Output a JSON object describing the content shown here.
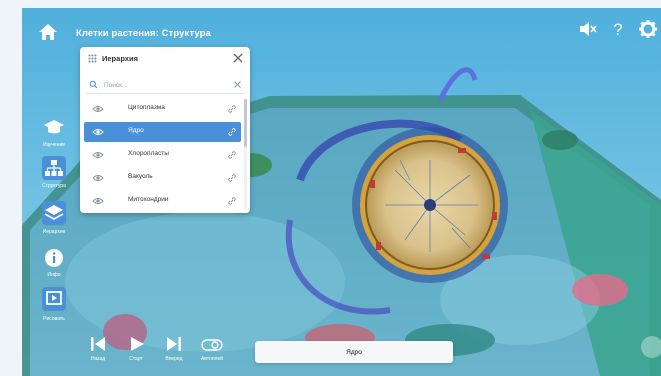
{
  "app": {
    "title": "Клетки растения: Структура"
  },
  "panel": {
    "title": "Иерархия",
    "search_placeholder": "Поиск...",
    "items": [
      {
        "label": "Цитоплазма",
        "selected": false
      },
      {
        "label": "Ядро",
        "selected": true
      },
      {
        "label": "Хлоропласты",
        "selected": false
      },
      {
        "label": "Вакуоль",
        "selected": false
      },
      {
        "label": "Митохондрии",
        "selected": false
      }
    ]
  },
  "sidebar": {
    "items": [
      {
        "label": "Изучение",
        "icon": "graduation-cap-icon"
      },
      {
        "label": "Структура",
        "icon": "hierarchy-icon"
      },
      {
        "label": "Иерархия",
        "icon": "layers-icon"
      },
      {
        "label": "Инфо",
        "icon": "info-icon"
      },
      {
        "label": "Рисовать",
        "icon": "presentation-icon"
      }
    ]
  },
  "controls": {
    "back": "Назад",
    "start": "Старт",
    "forward": "Вперед",
    "autoplay": "Автоплей"
  },
  "selected_label": "Ядро",
  "colors": {
    "accent": "#4a90d9",
    "sky": "#5fb3d8",
    "cell": "#3f9e8f"
  }
}
